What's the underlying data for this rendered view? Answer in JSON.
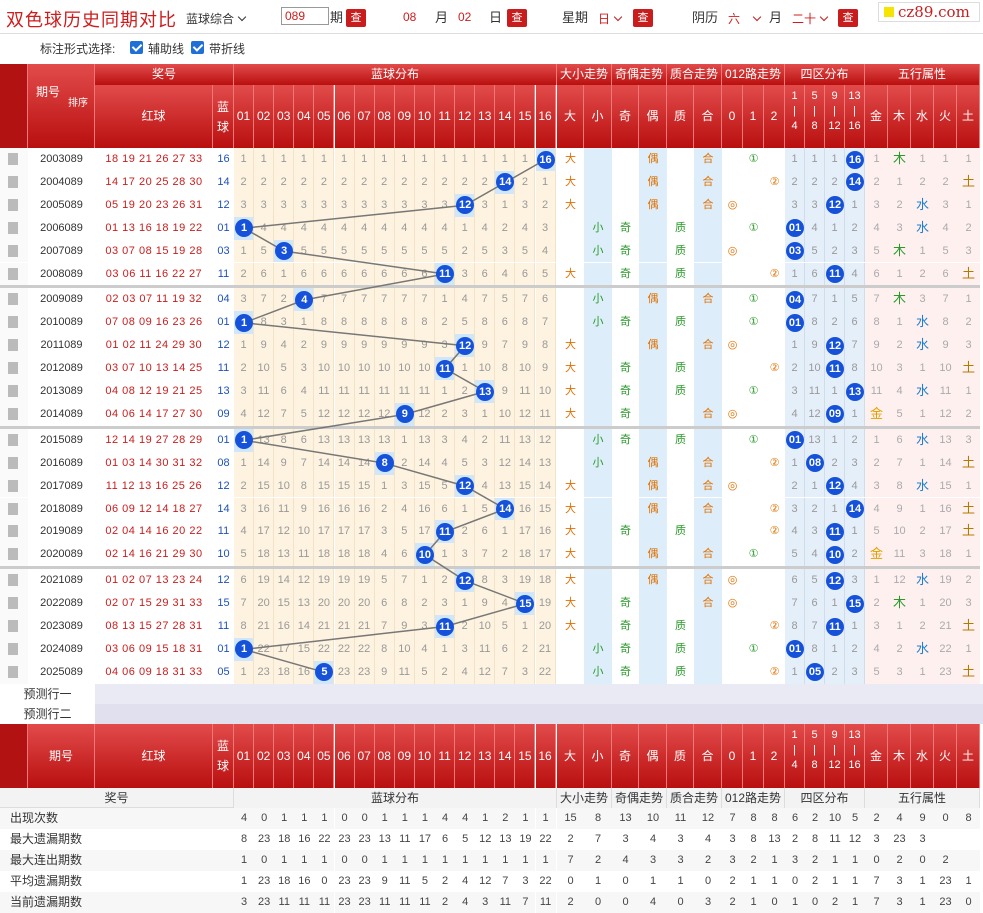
{
  "topbar": {
    "title": "双色球历史同期对比",
    "mode_select": "蓝球综合",
    "issue_value": "089",
    "issue_label": "期",
    "month_value": "08",
    "month_label": "月",
    "day_value": "02",
    "day_label": "日",
    "query_label": "查",
    "weekday_label": "星期",
    "weekday_value": "日",
    "lunar_label": "阴历",
    "lunar_month": "六",
    "lunar_month_label": "月",
    "lunar_day": "二十",
    "logo_text": "cz89.com"
  },
  "options": {
    "label": "标注形式选择:",
    "aux_line": "辅助线",
    "polyline": "带折线"
  },
  "header": {
    "issue": "期号",
    "sort": "排序",
    "prize_no": "奖号",
    "red": "红球",
    "blue": "蓝球",
    "blue_dist": "蓝球分布",
    "size": "大小走势",
    "parity": "奇偶走势",
    "prime": "质合走势",
    "route": "012路走势",
    "zone": "四区分布",
    "wuxing": "五行属性",
    "big": "大",
    "small": "小",
    "odd": "奇",
    "even": "偶",
    "zhi": "质",
    "he": "合",
    "r0": "0",
    "r1": "1",
    "r2": "2",
    "z1": "1|4",
    "z2": "5|8",
    "z3": "9|12",
    "z4": "13|16",
    "jin": "金",
    "mu": "木",
    "shui": "水",
    "huo": "火",
    "tu": "土"
  },
  "blue_numbers": [
    "01",
    "02",
    "03",
    "04",
    "05",
    "06",
    "07",
    "08",
    "09",
    "10",
    "11",
    "12",
    "13",
    "14",
    "15",
    "16"
  ],
  "rows": [
    {
      "issue": "2003089",
      "red": "18 19 21 26 27 33",
      "blue": "16",
      "dist": [
        1,
        1,
        1,
        1,
        1,
        1,
        1,
        1,
        1,
        1,
        1,
        1,
        1,
        1,
        1,
        "16"
      ],
      "size": "大",
      "odd": "",
      "even": "偶",
      "zhi": "",
      "he": "合",
      "route": "1",
      "zone": [
        1,
        1,
        1,
        "16"
      ],
      "wx": [
        1,
        "木",
        1,
        1,
        1
      ],
      "wxh": 1
    },
    {
      "issue": "2004089",
      "red": "14 17 20 25 28 30",
      "blue": "14",
      "dist": [
        2,
        2,
        2,
        2,
        2,
        2,
        2,
        2,
        2,
        2,
        2,
        2,
        2,
        "14",
        2,
        1
      ],
      "size": "大",
      "odd": "",
      "even": "偶",
      "zhi": "",
      "he": "合",
      "route": "2",
      "zone": [
        2,
        2,
        2,
        "14"
      ],
      "wx": [
        2,
        1,
        2,
        2,
        "土"
      ],
      "wxh": 4
    },
    {
      "issue": "2005089",
      "red": "05 19 20 23 26 31",
      "blue": "12",
      "dist": [
        3,
        3,
        3,
        3,
        3,
        3,
        3,
        3,
        3,
        3,
        3,
        "12",
        3,
        1,
        3,
        2
      ],
      "size": "大",
      "odd": "",
      "even": "偶",
      "zhi": "",
      "he": "合",
      "route": "0",
      "zone": [
        3,
        3,
        "12",
        1
      ],
      "wx": [
        3,
        2,
        "水",
        3,
        1
      ],
      "wxh": 2
    },
    {
      "issue": "2006089",
      "red": "01 13 16 18 19 22",
      "blue": "01",
      "dist": [
        "1",
        4,
        4,
        4,
        4,
        4,
        4,
        4,
        4,
        4,
        4,
        1,
        4,
        2,
        4,
        3
      ],
      "size": "小",
      "odd": "奇",
      "even": "",
      "zhi": "质",
      "he": "",
      "route": "1",
      "zone": [
        "01",
        4,
        1,
        2
      ],
      "wx": [
        4,
        3,
        "水",
        4,
        2
      ],
      "wxh": 2
    },
    {
      "issue": "2007089",
      "red": "03 07 08 15 19 28",
      "blue": "03",
      "dist": [
        1,
        5,
        "3",
        5,
        5,
        5,
        5,
        5,
        5,
        5,
        5,
        2,
        5,
        3,
        5,
        4
      ],
      "size": "小",
      "odd": "奇",
      "even": "",
      "zhi": "质",
      "he": "",
      "route": "0",
      "zone": [
        "03",
        5,
        2,
        3
      ],
      "wx": [
        5,
        "木",
        1,
        5,
        3
      ],
      "wxh": 1
    },
    {
      "issue": "2008089",
      "red": "03 06 11 16 22 27",
      "blue": "11",
      "dist": [
        2,
        6,
        1,
        6,
        6,
        6,
        6,
        6,
        6,
        6,
        "11",
        3,
        6,
        4,
        6,
        5
      ],
      "size": "大",
      "odd": "奇",
      "even": "",
      "zhi": "质",
      "he": "",
      "route": "2",
      "zone": [
        1,
        6,
        "11",
        4
      ],
      "wx": [
        6,
        1,
        2,
        6,
        "土"
      ],
      "wxh": 4
    },
    {
      "issue": "2009089",
      "red": "02 03 07 11 19 32",
      "blue": "04",
      "dist": [
        3,
        7,
        2,
        "4",
        7,
        7,
        7,
        7,
        7,
        7,
        1,
        4,
        7,
        5,
        7,
        6
      ],
      "size": "小",
      "odd": "",
      "even": "偶",
      "zhi": "",
      "he": "合",
      "route": "1",
      "zone": [
        "04",
        7,
        1,
        5
      ],
      "wx": [
        7,
        "木",
        3,
        7,
        1
      ],
      "wxh": 1
    },
    {
      "issue": "2010089",
      "red": "07 08 09 16 23 26",
      "blue": "01",
      "dist": [
        "1",
        8,
        3,
        1,
        8,
        8,
        8,
        8,
        8,
        8,
        2,
        5,
        8,
        6,
        8,
        7
      ],
      "size": "小",
      "odd": "奇",
      "even": "",
      "zhi": "质",
      "he": "",
      "route": "1",
      "zone": [
        "01",
        8,
        2,
        6
      ],
      "wx": [
        8,
        1,
        "水",
        8,
        2
      ],
      "wxh": 2
    },
    {
      "issue": "2011089",
      "red": "01 02 11 24 29 30",
      "blue": "12",
      "dist": [
        1,
        9,
        4,
        2,
        9,
        9,
        9,
        9,
        9,
        9,
        3,
        "12",
        9,
        7,
        9,
        8
      ],
      "size": "大",
      "odd": "",
      "even": "偶",
      "zhi": "",
      "he": "合",
      "route": "0",
      "zone": [
        1,
        9,
        "12",
        7
      ],
      "wx": [
        9,
        2,
        "水",
        9,
        3
      ],
      "wxh": 2
    },
    {
      "issue": "2012089",
      "red": "03 07 10 13 14 25",
      "blue": "11",
      "dist": [
        2,
        10,
        5,
        3,
        10,
        10,
        10,
        10,
        10,
        10,
        "11",
        1,
        10,
        8,
        10,
        9
      ],
      "size": "大",
      "odd": "奇",
      "even": "",
      "zhi": "质",
      "he": "",
      "route": "2",
      "zone": [
        2,
        10,
        "11",
        8
      ],
      "wx": [
        10,
        3,
        1,
        10,
        "土"
      ],
      "wxh": 4
    },
    {
      "issue": "2013089",
      "red": "04 08 12 19 21 25",
      "blue": "13",
      "dist": [
        3,
        11,
        6,
        4,
        11,
        11,
        11,
        11,
        11,
        11,
        1,
        2,
        "13",
        9,
        11,
        10
      ],
      "size": "大",
      "odd": "奇",
      "even": "",
      "zhi": "质",
      "he": "",
      "route": "1",
      "zone": [
        3,
        11,
        1,
        "13"
      ],
      "wx": [
        11,
        4,
        "水",
        11,
        1
      ],
      "wxh": 2
    },
    {
      "issue": "2014089",
      "red": "04 06 14 17 27 30",
      "blue": "09",
      "dist": [
        4,
        12,
        7,
        5,
        12,
        12,
        12,
        12,
        "9",
        12,
        2,
        3,
        1,
        10,
        12,
        11
      ],
      "size": "大",
      "odd": "奇",
      "even": "",
      "zhi": "",
      "he": "合",
      "route": "0",
      "zone": [
        4,
        12,
        "09",
        1
      ],
      "wx": [
        "金",
        5,
        1,
        12,
        2
      ],
      "wxh": 0
    },
    {
      "issue": "2015089",
      "red": "12 14 19 27 28 29",
      "blue": "01",
      "dist": [
        "1",
        13,
        8,
        6,
        13,
        13,
        13,
        13,
        1,
        13,
        3,
        4,
        2,
        11,
        13,
        12
      ],
      "size": "小",
      "odd": "奇",
      "even": "",
      "zhi": "质",
      "he": "",
      "route": "1",
      "zone": [
        "01",
        13,
        1,
        2
      ],
      "wx": [
        1,
        6,
        "水",
        13,
        3
      ],
      "wxh": 2
    },
    {
      "issue": "2016089",
      "red": "01 03 14 30 31 32",
      "blue": "08",
      "dist": [
        1,
        14,
        9,
        7,
        14,
        14,
        14,
        "8",
        2,
        14,
        4,
        5,
        3,
        12,
        14,
        13
      ],
      "size": "小",
      "odd": "",
      "even": "偶",
      "zhi": "",
      "he": "合",
      "route": "2",
      "zone": [
        1,
        "08",
        2,
        3
      ],
      "wx": [
        2,
        7,
        1,
        14,
        "土"
      ],
      "wxh": 4
    },
    {
      "issue": "2017089",
      "red": "11 12 13 16 25 26",
      "blue": "12",
      "dist": [
        2,
        15,
        10,
        8,
        15,
        15,
        15,
        1,
        3,
        15,
        5,
        "12",
        4,
        13,
        15,
        14
      ],
      "size": "大",
      "odd": "",
      "even": "偶",
      "zhi": "",
      "he": "合",
      "route": "0",
      "zone": [
        2,
        1,
        "12",
        4
      ],
      "wx": [
        3,
        8,
        "水",
        15,
        1
      ],
      "wxh": 2
    },
    {
      "issue": "2018089",
      "red": "06 09 12 14 18 27",
      "blue": "14",
      "dist": [
        3,
        16,
        11,
        9,
        16,
        16,
        16,
        2,
        4,
        16,
        6,
        1,
        5,
        "14",
        16,
        15
      ],
      "size": "大",
      "odd": "",
      "even": "偶",
      "zhi": "",
      "he": "合",
      "route": "2",
      "zone": [
        3,
        2,
        1,
        "14"
      ],
      "wx": [
        4,
        9,
        1,
        16,
        "土"
      ],
      "wxh": 4
    },
    {
      "issue": "2019089",
      "red": "02 04 14 16 20 22",
      "blue": "11",
      "dist": [
        4,
        17,
        12,
        10,
        17,
        17,
        17,
        3,
        5,
        17,
        "11",
        2,
        6,
        1,
        17,
        16
      ],
      "size": "大",
      "odd": "奇",
      "even": "",
      "zhi": "质",
      "he": "",
      "route": "2",
      "zone": [
        4,
        3,
        "11",
        1
      ],
      "wx": [
        5,
        10,
        2,
        17,
        "土"
      ],
      "wxh": 4
    },
    {
      "issue": "2020089",
      "red": "02 14 16 21 29 30",
      "blue": "10",
      "dist": [
        5,
        18,
        13,
        11,
        18,
        18,
        18,
        4,
        6,
        "10",
        1,
        3,
        7,
        2,
        18,
        17
      ],
      "size": "大",
      "odd": "",
      "even": "偶",
      "zhi": "",
      "he": "合",
      "route": "1",
      "zone": [
        5,
        4,
        "10",
        2
      ],
      "wx": [
        "金",
        11,
        3,
        18,
        1
      ],
      "wxh": 0
    },
    {
      "issue": "2021089",
      "red": "01 02 07 13 23 24",
      "blue": "12",
      "dist": [
        6,
        19,
        14,
        12,
        19,
        19,
        19,
        5,
        7,
        1,
        2,
        "12",
        8,
        3,
        19,
        18
      ],
      "size": "大",
      "odd": "",
      "even": "偶",
      "zhi": "",
      "he": "合",
      "route": "0",
      "zone": [
        6,
        5,
        "12",
        3
      ],
      "wx": [
        1,
        12,
        "水",
        19,
        2
      ],
      "wxh": 2
    },
    {
      "issue": "2022089",
      "red": "02 07 15 29 31 33",
      "blue": "15",
      "dist": [
        7,
        20,
        15,
        13,
        20,
        20,
        20,
        6,
        8,
        2,
        3,
        1,
        9,
        4,
        "15",
        19
      ],
      "size": "大",
      "odd": "奇",
      "even": "",
      "zhi": "",
      "he": "合",
      "route": "0",
      "zone": [
        7,
        6,
        1,
        "15"
      ],
      "wx": [
        2,
        "木",
        1,
        20,
        3
      ],
      "wxh": 1
    },
    {
      "issue": "2023089",
      "red": "08 13 15 27 28 31",
      "blue": "11",
      "dist": [
        8,
        21,
        16,
        14,
        21,
        21,
        21,
        7,
        9,
        3,
        "11",
        2,
        10,
        5,
        1,
        20
      ],
      "size": "大",
      "odd": "奇",
      "even": "",
      "zhi": "质",
      "he": "",
      "route": "2",
      "zone": [
        8,
        7,
        "11",
        1
      ],
      "wx": [
        3,
        1,
        2,
        21,
        "土"
      ],
      "wxh": 4
    },
    {
      "issue": "2024089",
      "red": "03 06 09 15 18 31",
      "blue": "01",
      "dist": [
        "1",
        22,
        17,
        15,
        22,
        22,
        22,
        8,
        10,
        4,
        1,
        3,
        11,
        6,
        2,
        21
      ],
      "size": "小",
      "odd": "奇",
      "even": "",
      "zhi": "质",
      "he": "",
      "route": "1",
      "zone": [
        "01",
        8,
        1,
        2
      ],
      "wx": [
        4,
        2,
        "水",
        22,
        1
      ],
      "wxh": 2
    },
    {
      "issue": "2025089",
      "red": "04 06 09 18 31 33",
      "blue": "05",
      "dist": [
        1,
        23,
        18,
        16,
        "5",
        23,
        23,
        9,
        11,
        5,
        2,
        4,
        12,
        7,
        3,
        22
      ],
      "size": "小",
      "odd": "奇",
      "even": "",
      "zhi": "质",
      "he": "",
      "route": "2",
      "zone": [
        1,
        "05",
        2,
        3
      ],
      "wx": [
        5,
        3,
        1,
        23,
        "土"
      ],
      "wxh": 4
    }
  ],
  "predict": [
    "预测行一",
    "预测行二"
  ],
  "stats": [
    {
      "label": "出现次数",
      "vals": [
        4,
        0,
        1,
        1,
        1,
        0,
        0,
        1,
        1,
        1,
        4,
        4,
        1,
        2,
        1,
        1,
        15,
        8,
        13,
        10,
        11,
        12,
        7,
        8,
        8,
        6,
        2,
        10,
        5,
        2,
        4,
        9,
        0,
        8
      ]
    },
    {
      "label": "最大遗漏期数",
      "vals": [
        8,
        23,
        18,
        16,
        22,
        23,
        23,
        13,
        11,
        17,
        6,
        5,
        12,
        13,
        19,
        22,
        2,
        7,
        3,
        4,
        3,
        4,
        3,
        8,
        13,
        2,
        8,
        11,
        12,
        3,
        23,
        3
      ]
    },
    {
      "label": "最大连出期数",
      "vals": [
        1,
        0,
        1,
        1,
        1,
        0,
        0,
        1,
        1,
        1,
        1,
        1,
        1,
        1,
        1,
        1,
        7,
        2,
        4,
        3,
        3,
        2,
        3,
        2,
        1,
        3,
        2,
        1,
        1,
        0,
        2,
        0,
        2
      ]
    },
    {
      "label": "平均遗漏期数",
      "vals": [
        1,
        23,
        18,
        16,
        0,
        23,
        23,
        9,
        11,
        5,
        2,
        4,
        12,
        7,
        3,
        22,
        0,
        1,
        0,
        1,
        1,
        0,
        2,
        1,
        1,
        0,
        2,
        1,
        1,
        7,
        3,
        1,
        23,
        1
      ]
    },
    {
      "label": "当前遗漏期数",
      "vals": [
        3,
        23,
        11,
        11,
        11,
        23,
        23,
        11,
        11,
        11,
        2,
        4,
        3,
        11,
        7,
        11,
        2,
        0,
        0,
        4,
        0,
        3,
        2,
        1,
        0,
        1,
        0,
        2,
        1,
        7,
        3,
        1,
        23,
        0
      ]
    }
  ]
}
